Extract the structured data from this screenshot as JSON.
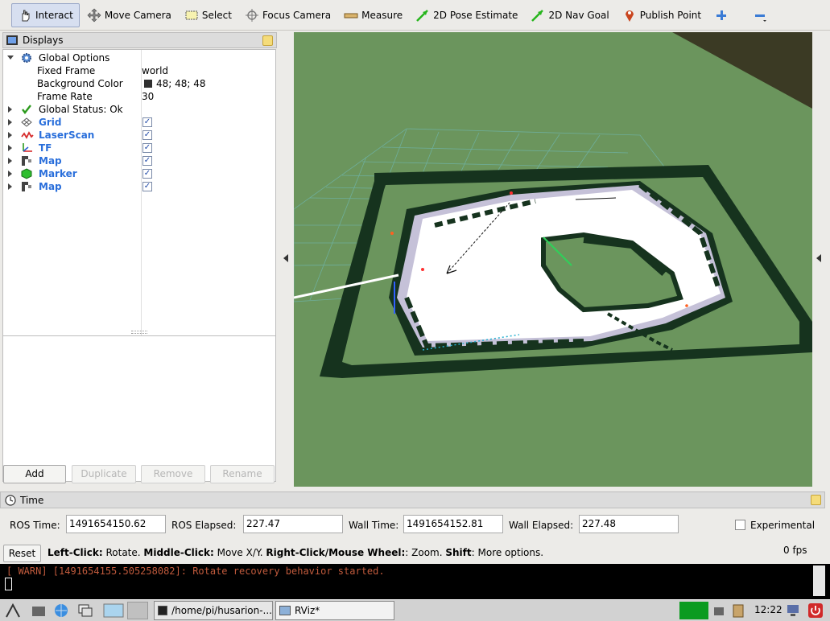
{
  "toolbar": {
    "tools": [
      {
        "label": "Interact",
        "icon": "hand-icon"
      },
      {
        "label": "Move Camera",
        "icon": "move-icon"
      },
      {
        "label": "Select",
        "icon": "select-icon"
      },
      {
        "label": "Focus Camera",
        "icon": "focus-icon"
      },
      {
        "label": "Measure",
        "icon": "ruler-icon"
      },
      {
        "label": "2D Pose Estimate",
        "icon": "pose-arrow-icon"
      },
      {
        "label": "2D Nav Goal",
        "icon": "nav-arrow-icon"
      },
      {
        "label": "Publish Point",
        "icon": "pin-icon"
      }
    ]
  },
  "displays": {
    "title": "Displays",
    "global_options": "Global Options",
    "fixed_frame_label": "Fixed Frame",
    "fixed_frame_value": "world",
    "bg_color_label": "Background Color",
    "bg_color_value": "48; 48; 48",
    "frame_rate_label": "Frame Rate",
    "frame_rate_value": "30",
    "global_status": "Global Status: Ok",
    "items": [
      {
        "label": "Grid"
      },
      {
        "label": "LaserScan"
      },
      {
        "label": "TF"
      },
      {
        "label": "Map"
      },
      {
        "label": "Marker"
      },
      {
        "label": "Map"
      }
    ],
    "buttons": {
      "add": "Add",
      "duplicate": "Duplicate",
      "remove": "Remove",
      "rename": "Rename"
    }
  },
  "time": {
    "title": "Time",
    "ros_time_label": "ROS Time:",
    "ros_time_value": "1491654150.62",
    "ros_elapsed_label": "ROS Elapsed:",
    "ros_elapsed_value": "227.47",
    "wall_time_label": "Wall Time:",
    "wall_time_value": "1491654152.81",
    "wall_elapsed_label": "Wall Elapsed:",
    "wall_elapsed_value": "227.48",
    "experimental_label": "Experimental",
    "reset_label": "Reset",
    "hint_parts": [
      "Left-Click:",
      " Rotate. ",
      "Middle-Click:",
      " Move X/Y. ",
      "Right-Click/Mouse Wheel:",
      ": Zoom. ",
      "Shift",
      ": More options."
    ],
    "fps": "0 fps"
  },
  "console": {
    "line": "[ WARN] [1491654155.505258082]: Rotate recovery behavior started."
  },
  "taskbar": {
    "terminal_task": "/home/pi/husarion-...",
    "rviz_task": "RViz*",
    "clock": "12:22"
  },
  "colors": {
    "view_bg": "#6b955d",
    "map_wall": "#16331e",
    "link_blue": "#2a6fdb",
    "warn_text": "#c05a3c"
  }
}
